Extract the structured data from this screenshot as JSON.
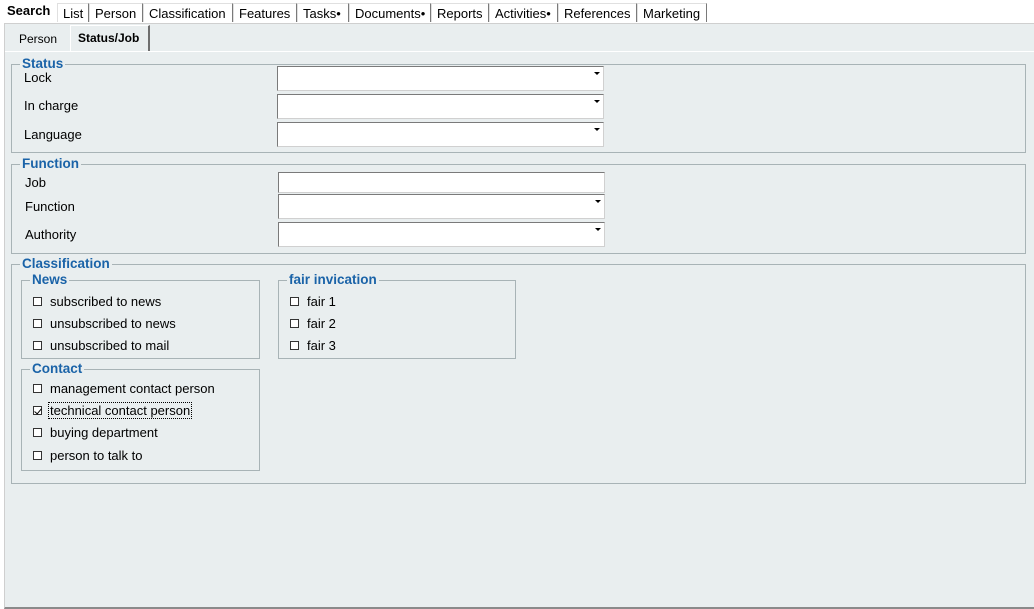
{
  "top_tabs": [
    {
      "label": "Search"
    },
    {
      "label": "List"
    },
    {
      "label": "Person"
    },
    {
      "label": "Classification"
    },
    {
      "label": "Features"
    },
    {
      "label": "Tasks•"
    },
    {
      "label": "Documents•"
    },
    {
      "label": "Reports"
    },
    {
      "label": "Activities•"
    },
    {
      "label": "References"
    },
    {
      "label": "Marketing"
    }
  ],
  "sub_tabs": [
    {
      "label": "Person"
    },
    {
      "label": "Status/Job"
    }
  ],
  "status": {
    "legend": "Status",
    "lock": {
      "label": "Lock",
      "value": ""
    },
    "in_charge": {
      "label": "In charge",
      "value": ""
    },
    "language": {
      "label": "Language",
      "value": ""
    }
  },
  "function": {
    "legend": "Function",
    "job": {
      "label": "Job",
      "value": ""
    },
    "function": {
      "label": "Function",
      "value": ""
    },
    "authority": {
      "label": "Authority",
      "value": ""
    }
  },
  "classification": {
    "legend": "Classification",
    "news": {
      "legend": "News",
      "items": [
        {
          "label": "subscribed to news",
          "checked": false
        },
        {
          "label": "unsubscribed to news",
          "checked": false
        },
        {
          "label": "unsubscribed to mail",
          "checked": false
        }
      ]
    },
    "fair": {
      "legend": "fair invication",
      "items": [
        {
          "label": "fair 1",
          "checked": false
        },
        {
          "label": "fair 2",
          "checked": false
        },
        {
          "label": "fair 3",
          "checked": false
        }
      ]
    },
    "contact": {
      "legend": "Contact",
      "items": [
        {
          "label": "management contact person",
          "checked": false
        },
        {
          "label": "technical contact person",
          "checked": true
        },
        {
          "label": "buying department",
          "checked": false
        },
        {
          "label": "person to talk to",
          "checked": false
        }
      ]
    }
  }
}
